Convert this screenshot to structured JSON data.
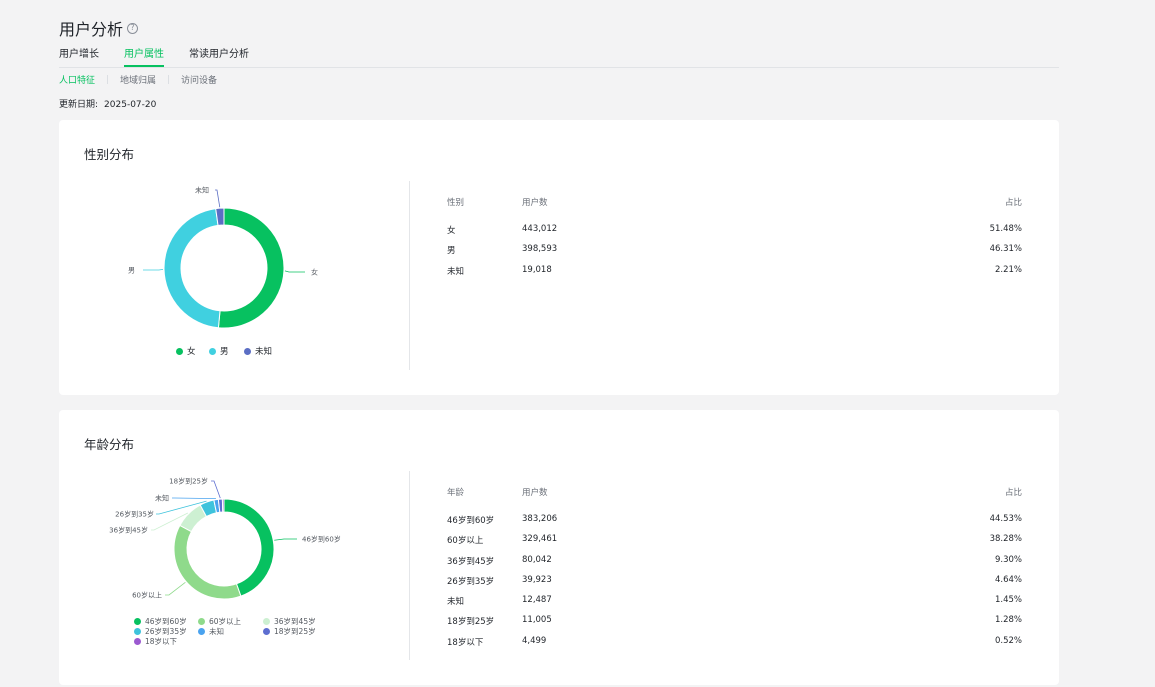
{
  "header": {
    "title": "用户分析",
    "help_icon": "question-circle-icon"
  },
  "tabs": [
    {
      "label": "用户增长",
      "active": false
    },
    {
      "label": "用户属性",
      "active": true
    },
    {
      "label": "常读用户分析",
      "active": false
    }
  ],
  "subtabs": [
    {
      "label": "人口特征",
      "active": true
    },
    {
      "label": "地域归属",
      "active": false
    },
    {
      "label": "访问设备",
      "active": false
    }
  ],
  "update": {
    "label": "更新日期:",
    "date": "2025-07-20"
  },
  "colors": {
    "accent": "#07c160",
    "gender": [
      "#07c160",
      "#40d0e0",
      "#5b6ec4"
    ],
    "age": [
      "#07c160",
      "#8fda8b",
      "#cdf0d2",
      "#3ec3dc",
      "#4aa3ef",
      "#5d6ed0",
      "#9b59d0"
    ]
  },
  "gender": {
    "title": "性别分布",
    "table": {
      "headers": [
        "性别",
        "用户数",
        "占比"
      ],
      "rows": [
        {
          "name": "女",
          "count": "443,012",
          "pct": "51.48%"
        },
        {
          "name": "男",
          "count": "398,593",
          "pct": "46.31%"
        },
        {
          "name": "未知",
          "count": "19,018",
          "pct": "2.21%"
        }
      ]
    },
    "legend": [
      "女",
      "男",
      "未知"
    ]
  },
  "age": {
    "title": "年龄分布",
    "table": {
      "headers": [
        "年龄",
        "用户数",
        "占比"
      ],
      "rows": [
        {
          "name": "46岁到60岁",
          "count": "383,206",
          "pct": "44.53%"
        },
        {
          "name": "60岁以上",
          "count": "329,461",
          "pct": "38.28%"
        },
        {
          "name": "36岁到45岁",
          "count": "80,042",
          "pct": "9.30%"
        },
        {
          "name": "26岁到35岁",
          "count": "39,923",
          "pct": "4.64%"
        },
        {
          "name": "未知",
          "count": "12,487",
          "pct": "1.45%"
        },
        {
          "name": "18岁到25岁",
          "count": "11,005",
          "pct": "1.28%"
        },
        {
          "name": "18岁以下",
          "count": "4,499",
          "pct": "0.52%"
        }
      ]
    },
    "legend": [
      "46岁到60岁",
      "60岁以上",
      "36岁到45岁",
      "26岁到35岁",
      "未知",
      "18岁到25岁",
      "18岁以下"
    ]
  },
  "chart_data": [
    {
      "type": "pie",
      "title": "性别分布",
      "categories": [
        "女",
        "男",
        "未知"
      ],
      "values": [
        51.48,
        46.31,
        2.21
      ],
      "counts": [
        443012,
        398593,
        19018
      ],
      "legend": "bottom"
    },
    {
      "type": "pie",
      "title": "年龄分布",
      "categories": [
        "46岁到60岁",
        "60岁以上",
        "36岁到45岁",
        "26岁到35岁",
        "未知",
        "18岁到25岁",
        "18岁以下"
      ],
      "values": [
        44.53,
        38.28,
        9.3,
        4.64,
        1.45,
        1.28,
        0.52
      ],
      "counts": [
        383206,
        329461,
        80042,
        39923,
        12487,
        11005,
        4499
      ],
      "legend": "bottom"
    }
  ]
}
